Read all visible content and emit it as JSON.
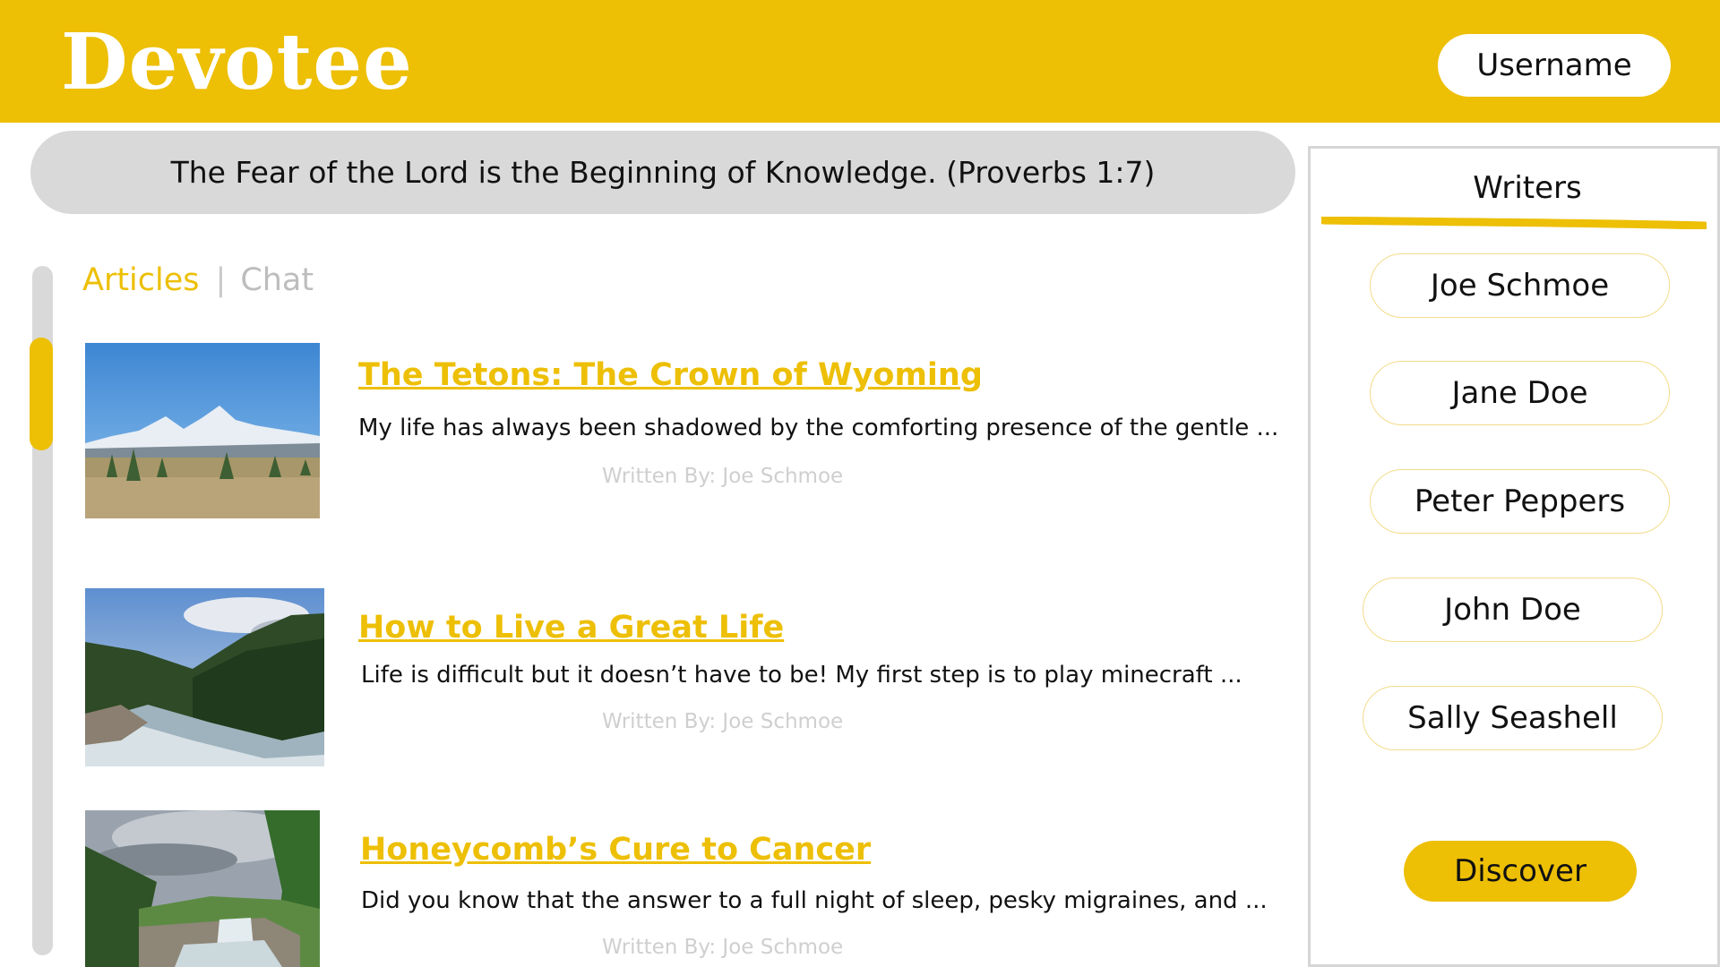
{
  "header": {
    "logo": "Devotee",
    "username_label": "Username"
  },
  "verse": {
    "text": "The Fear of the Lord is the Beginning of Knowledge. (Proverbs 1:7)"
  },
  "tabs": {
    "articles_label": "Articles",
    "separator": "|",
    "chat_label": "Chat"
  },
  "articles": [
    {
      "title": "The Tetons: The Crown of  Wyoming",
      "excerpt": "My life has always been shadowed by the comforting presence of the gentle ...",
      "author": "Written By: Joe Schmoe",
      "image": "mountain-landscape"
    },
    {
      "title": "How to Live a Great Life",
      "excerpt": "Life is difficult but it doesn’t have to be! My first step is to play minecraft ...",
      "author": "Written By: Joe Schmoe",
      "image": "river-forest"
    },
    {
      "title": "Honeycomb’s Cure to Cancer",
      "excerpt": "Did you know that the answer to a full night of sleep, pesky migraines, and ...",
      "author": "Written By: Joe Schmoe",
      "image": "waterfall-canyon"
    }
  ],
  "sidebar": {
    "title": "Writers",
    "writers": [
      {
        "name": "Joe Schmoe"
      },
      {
        "name": "Jane Doe"
      },
      {
        "name": "Peter Peppers"
      },
      {
        "name": "John Doe"
      },
      {
        "name": "Sally Seashell"
      }
    ],
    "discover_label": "Discover"
  },
  "colors": {
    "accent": "#EDBF05",
    "pill_gray": "#D9D9D9",
    "muted_text": "#CFCFCF"
  }
}
